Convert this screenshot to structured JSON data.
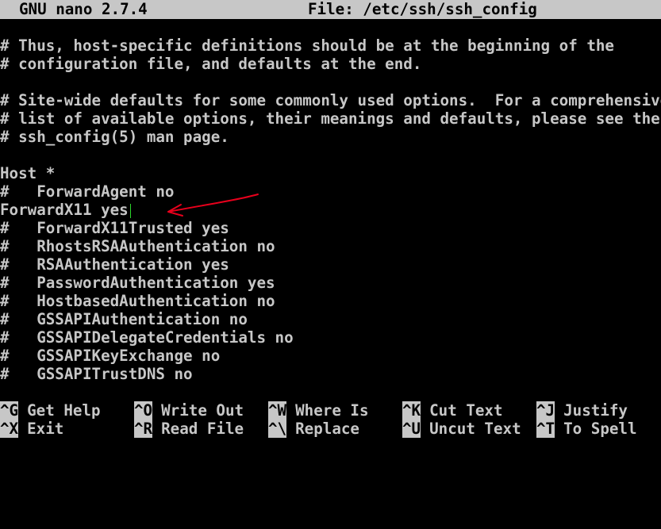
{
  "titlebar": {
    "app_name": "GNU nano 2.7.4",
    "file_label": "File: /etc/ssh/ssh_config"
  },
  "editor": {
    "lines": [
      "",
      "# Thus, host-specific definitions should be at the beginning of the",
      "# configuration file, and defaults at the end.",
      "",
      "# Site-wide defaults for some commonly used options.  For a comprehensive",
      "# list of available options, their meanings and defaults, please see the",
      "# ssh_config(5) man page.",
      "",
      "Host *",
      "#   ForwardAgent no",
      "ForwardX11 yes",
      "#   ForwardX11Trusted yes",
      "#   RhostsRSAAuthentication no",
      "#   RSAAuthentication yes",
      "#   PasswordAuthentication yes",
      "#   HostbasedAuthentication no",
      "#   GSSAPIAuthentication no",
      "#   GSSAPIDelegateCredentials no",
      "#   GSSAPIKeyExchange no",
      "#   GSSAPITrustDNS no"
    ],
    "cursor_line_index": 10,
    "annotation_color": "#e8001c",
    "cursor_color": "#2bd62b"
  },
  "shortcuts": {
    "row1": [
      {
        "key": "^G",
        "label": "Get Help"
      },
      {
        "key": "^O",
        "label": "Write Out"
      },
      {
        "key": "^W",
        "label": "Where Is"
      },
      {
        "key": "^K",
        "label": "Cut Text"
      },
      {
        "key": "^J",
        "label": "Justify"
      }
    ],
    "row2": [
      {
        "key": "^X",
        "label": "Exit"
      },
      {
        "key": "^R",
        "label": "Read File"
      },
      {
        "key": "^\\",
        "label": "Replace"
      },
      {
        "key": "^U",
        "label": "Uncut Text"
      },
      {
        "key": "^T",
        "label": "To Spell"
      }
    ]
  },
  "colors": {
    "background": "#000000",
    "foreground": "#c7c7c7",
    "inverse_bg": "#c7c7c7",
    "inverse_fg": "#000000"
  }
}
